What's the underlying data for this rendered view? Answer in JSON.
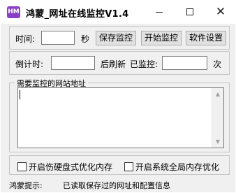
{
  "window": {
    "icon_text": "HM",
    "title": "鸿蒙_网址在线监控V1.4",
    "minimize": "minimize",
    "maximize": "maximize",
    "close": "✕"
  },
  "row1": {
    "time_label": "时间:",
    "time_value": "",
    "seconds_label": "秒",
    "save_button": "保存监控",
    "start_button": "开始监控",
    "settings_button": "软件设置"
  },
  "row2": {
    "countdown_label": "倒计时:",
    "countdown_value": "",
    "refresh_label": "后刷新",
    "monitored_label": "已监控:",
    "monitored_value": "",
    "times_label": "次"
  },
  "urls": {
    "legend": "需要监控的网站地址",
    "value": ""
  },
  "options": {
    "hard_disk_opt": "开启伤硬盘式优化内存",
    "system_opt": "开启系统全局内存优化"
  },
  "status": {
    "label": "鸿蒙提示:",
    "message": "已读取保存过的网址和配置信息"
  },
  "icons": {
    "scroll_up": "▲",
    "scroll_down": "▼"
  }
}
